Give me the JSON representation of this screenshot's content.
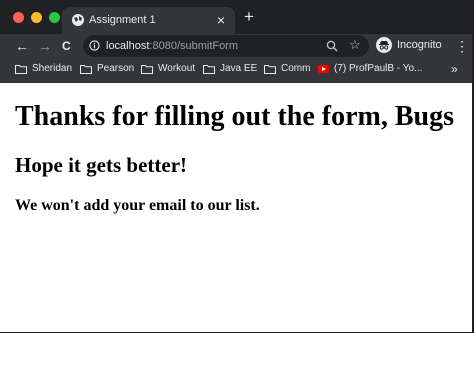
{
  "browser": {
    "traffic_lights": [
      {
        "name": "close",
        "color": "#ff5f57"
      },
      {
        "name": "minimize",
        "color": "#febc2e"
      },
      {
        "name": "zoom",
        "color": "#28c840"
      }
    ],
    "tab": {
      "title": "Assignment 1",
      "close_glyph": "×",
      "favicon": "globe-icon"
    },
    "new_tab_glyph": "+",
    "nav": {
      "back": "←",
      "forward": "→",
      "reload": "C"
    },
    "url": {
      "host": "localhost",
      "rest": ":8080/submitForm"
    },
    "star_glyph": "☆",
    "profile_label": "Incognito",
    "menu_glyph": "⋮",
    "bookmarks": [
      {
        "label": "Sheridan",
        "icon": "folder-icon"
      },
      {
        "label": "Pearson",
        "icon": "folder-icon"
      },
      {
        "label": "Workout",
        "icon": "folder-icon"
      },
      {
        "label": "Java EE",
        "icon": "folder-icon"
      },
      {
        "label": "Comm",
        "icon": "folder-icon"
      },
      {
        "label": "(7) ProfPaulB - Yo...",
        "icon": "youtube-icon"
      }
    ],
    "bookmarks_overflow": "»"
  },
  "page": {
    "heading": "Thanks for filling out the form, Bugs",
    "subheading": "Hope it gets better!",
    "message": "We won't add your email to our list."
  }
}
